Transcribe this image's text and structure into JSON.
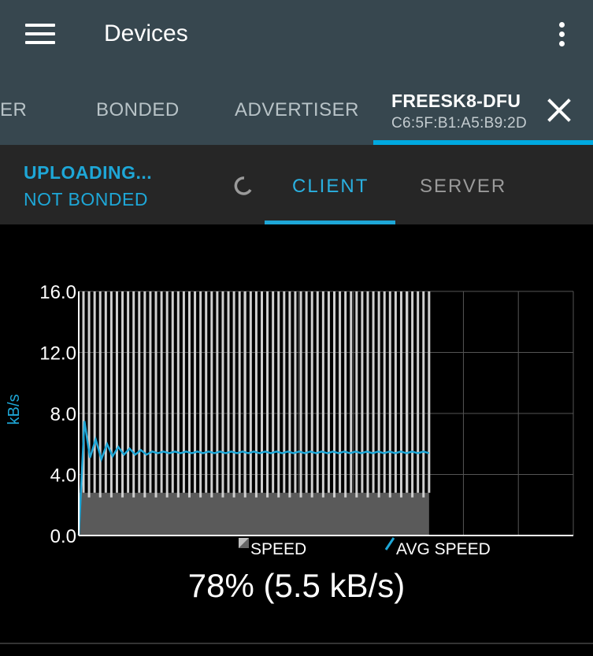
{
  "appbar": {
    "title": "Devices",
    "tabs": [
      {
        "label": "ER"
      },
      {
        "label": "BONDED"
      },
      {
        "label": "ADVERTISER"
      }
    ],
    "active_tab": {
      "name": "FREESK8-DFU",
      "address": "C6:5F:B1:A5:B9:2D"
    }
  },
  "status": {
    "line1": "UPLOADING...",
    "line2": "NOT BONDED"
  },
  "subtabs": {
    "client": "CLIENT",
    "server": "SERVER"
  },
  "chart_data": {
    "type": "bar",
    "ylabel": "kB/s",
    "ylim": [
      0,
      16
    ],
    "yticks": [
      "16.0",
      "12.0",
      "8.0",
      "4.0",
      "0.0"
    ],
    "grid": true,
    "legend": [
      "SPEED",
      "AVG SPEED"
    ],
    "speed_area_base": 2.8,
    "speed_spikes": [
      16,
      16,
      16,
      16,
      16,
      16,
      16,
      16,
      16,
      16,
      16,
      16,
      16,
      16,
      16,
      16,
      16,
      16,
      16,
      16,
      16,
      16,
      16,
      16,
      16,
      16,
      16,
      16,
      16,
      16,
      16,
      16,
      16,
      16,
      16,
      16,
      16,
      16,
      16,
      16,
      16,
      16,
      16,
      16,
      16,
      16,
      16,
      16,
      16,
      16,
      16,
      16,
      16,
      16,
      16,
      16,
      16,
      16,
      16,
      16,
      16,
      16,
      16
    ],
    "avg_speed": [
      0,
      7.5,
      5.1,
      6.3,
      5.0,
      6.0,
      5.2,
      5.8,
      5.3,
      5.7,
      5.3,
      5.6,
      5.3,
      5.5,
      5.4,
      5.5,
      5.4,
      5.5,
      5.4,
      5.5,
      5.4,
      5.5,
      5.4,
      5.5,
      5.4,
      5.5,
      5.4,
      5.5,
      5.4,
      5.5,
      5.4,
      5.5,
      5.4,
      5.5,
      5.4,
      5.5,
      5.4,
      5.5,
      5.4,
      5.5,
      5.4,
      5.5,
      5.4,
      5.5,
      5.4,
      5.5,
      5.4,
      5.5,
      5.4,
      5.5,
      5.4,
      5.5,
      5.4,
      5.5,
      5.4,
      5.5,
      5.4,
      5.5,
      5.4,
      5.5,
      5.4,
      5.5,
      5.4
    ],
    "x_fraction_filled": 0.78
  },
  "progress_text": "78% (5.5 kB/s)",
  "colors": {
    "appbar": "#37474f",
    "accent": "#1ea7d7",
    "speed": "#cccccc",
    "avg": "#1ea7d7"
  }
}
